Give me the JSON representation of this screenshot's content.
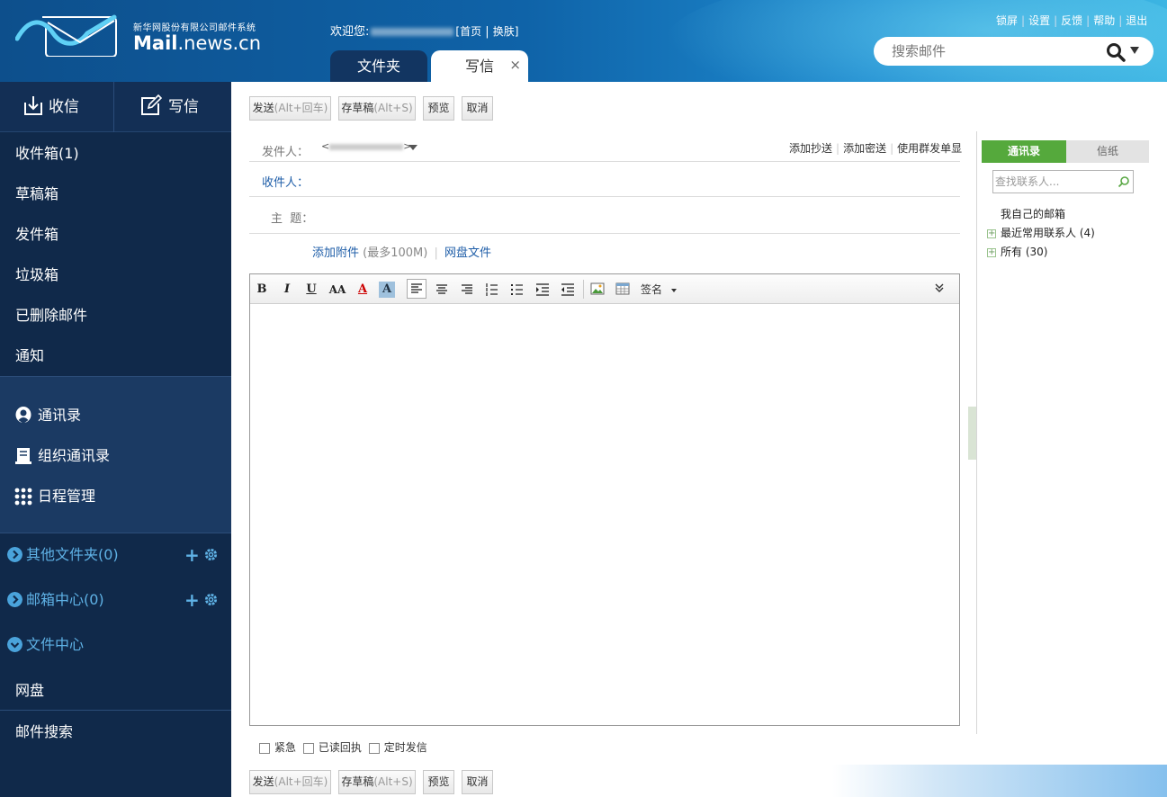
{
  "header": {
    "logo_sub": "新华网股份有限公司邮件系统",
    "logo_main_bold": "Mail",
    "logo_main_rest": ".news.cn",
    "welcome_prefix": "欢迎您:",
    "home_link": "[首页",
    "skin_link": "换肤]",
    "top_links": [
      "锁屏",
      "设置",
      "反馈",
      "帮助",
      "退出"
    ],
    "search_placeholder": "搜索邮件",
    "tabs": [
      {
        "label": "文件夹"
      },
      {
        "label": "写信",
        "close": "×"
      }
    ]
  },
  "sidebar": {
    "receive_label": "收信",
    "compose_label": "写信",
    "folders": [
      "收件箱(1)",
      "草稿箱",
      "发件箱",
      "垃圾箱",
      "已删除邮件",
      "通知"
    ],
    "tools": [
      {
        "label": "通讯录",
        "icon": "contact-icon"
      },
      {
        "label": "组织通讯录",
        "icon": "org-book-icon"
      },
      {
        "label": "日程管理",
        "icon": "calendar-dots-icon"
      }
    ],
    "other_folders": "其他文件夹(0)",
    "mailbox_center": "邮箱中心(0)",
    "file_center": "文件中心",
    "netdisk": "网盘",
    "mail_search": "邮件搜索"
  },
  "compose": {
    "buttons": {
      "send": "发送",
      "send_hint": "(Alt+回车)",
      "save": "存草稿",
      "save_hint": "(Alt+S)",
      "preview": "预览",
      "cancel": "取消"
    },
    "from_label": "发件人：",
    "from_lt": "<",
    "from_gt": ">",
    "add_cc": "添加抄送",
    "add_bcc": "添加密送",
    "group_single": "使用群发单显",
    "to_label": "收件人：",
    "subject_label": "主  题：",
    "add_attachment": "添加附件",
    "attachment_limit": "(最多100M)",
    "netdisk_file": "网盘文件",
    "toolbar": {
      "bold": "B",
      "italic": "I",
      "underline": "U",
      "font_size": "AA",
      "font_color": "A",
      "bg_color": "A",
      "signature": "签名"
    },
    "options": [
      "紧急",
      "已读回执",
      "定时发信"
    ]
  },
  "right_panel": {
    "tab_contacts": "通讯录",
    "tab_paper": "信纸",
    "search_placeholder": "查找联系人...",
    "my_mailbox": "我自己的邮箱",
    "recent": "最近常用联系人 (4)",
    "all": "所有 (30)"
  },
  "colors": {
    "sidebar_bg": "#10294a",
    "sidebar_section": "#1b3a63",
    "accent_green": "#55a93c",
    "link_blue": "#1f5ea8",
    "folder_blue": "#5fb2e6"
  }
}
